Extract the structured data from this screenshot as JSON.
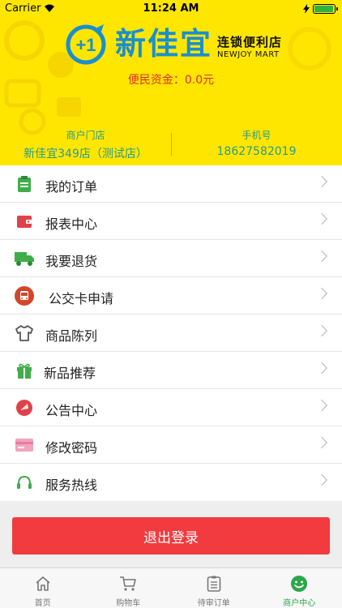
{
  "status_bar": {
    "carrier": "Carrier",
    "time": "11:24 AM",
    "battery_level": 0.95
  },
  "header": {
    "brand": "新佳宜",
    "chain": "连锁便利店",
    "chain_en": "NEWJOY MART",
    "badge_text": "+1",
    "fund_label": "便民资金：",
    "fund_value": "0.0元",
    "store_label": "商户门店",
    "store_value": "新佳宜349店（测试店）",
    "phone_label": "手机号",
    "phone_value": "18627582019"
  },
  "menu": [
    {
      "label": "我的订单",
      "icon": "clipboard-icon",
      "color": "#3fae49"
    },
    {
      "label": "报表中心",
      "icon": "wallet-icon",
      "color": "#e0424a"
    },
    {
      "label": "我要退货",
      "icon": "truck-icon",
      "color": "#3fae49"
    },
    {
      "label": "公交卡申请",
      "icon": "bus-icon",
      "color": "#d2462b"
    },
    {
      "label": "商品陈列",
      "icon": "shirt-icon",
      "color": "#555555"
    },
    {
      "label": "新品推荐",
      "icon": "gift-icon",
      "color": "#3fae49"
    },
    {
      "label": "公告中心",
      "icon": "megaphone-icon",
      "color": "#e0424a"
    },
    {
      "label": "修改密码",
      "icon": "card-icon",
      "color": "#e87ba0"
    },
    {
      "label": "服务热线",
      "icon": "headset-icon",
      "color": "#3fae49"
    }
  ],
  "logout_label": "退出登录",
  "tabs": [
    {
      "label": "首页",
      "icon": "home-icon"
    },
    {
      "label": "购物车",
      "icon": "cart-icon"
    },
    {
      "label": "待审订单",
      "icon": "order-list-icon"
    },
    {
      "label": "商户中心",
      "icon": "smile-icon",
      "active": true
    }
  ]
}
